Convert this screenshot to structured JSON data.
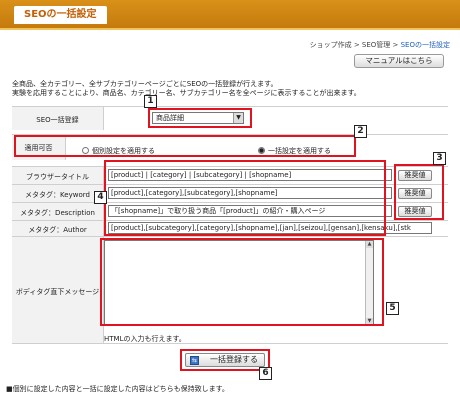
{
  "header": {
    "title": "SEOの一括設定"
  },
  "breadcrumb": {
    "part1": "ショップ作成 > SEO管理 > ",
    "current": "SEOの一括設定"
  },
  "manual_button": "マニュアルはこちら",
  "description": {
    "line1": "全商品、全カテゴリー、全サブカテゴリーページごとにSEOの一括登録が行えます。",
    "line2": "実験を応用することにより、商品名、カテゴリー名、サブカテゴリー名を全ページに表示することが出来ます。"
  },
  "form": {
    "seo_register": {
      "label": "SEO一括登録",
      "selected": "商品詳細"
    },
    "apply": {
      "label": "適用可否",
      "option1": "個別設定を適用する",
      "option2": "一括設定を適用する",
      "checked": 2
    },
    "browser_title": {
      "label": "ブラウザータイトル",
      "value": "[product] | [category] | [subcategory] | [shopname]"
    },
    "meta_keyword": {
      "label": "メタタグ：Keyword",
      "value": "[product],[category],[subcategory],[shopname]"
    },
    "meta_description": {
      "label": "メタタグ：Description",
      "value": "「[shopname]」で取り扱う商品「[product]」の紹介・購入ページ"
    },
    "meta_author": {
      "label": "メタタグ：Author",
      "value": "[product],[subcategory],[category],[shopname],[jan],[seizou],[gensan],[kensaku],[stk"
    },
    "body_message": {
      "label": "ボディタグ直下メッセージ",
      "value": "",
      "note": "HTMLの入力も行えます。"
    },
    "recommend_label": "推奨値"
  },
  "register_button": "一括登録する",
  "footer_note": "■個別に設定した内容と一括に設定した内容はどちらも保持致します。",
  "annotations": [
    "1",
    "2",
    "3",
    "4",
    "5",
    "6"
  ],
  "colors": {
    "header": "#d9911a",
    "title": "#c45f05",
    "annotation": "#e0141e",
    "link": "#1f5fbf"
  }
}
